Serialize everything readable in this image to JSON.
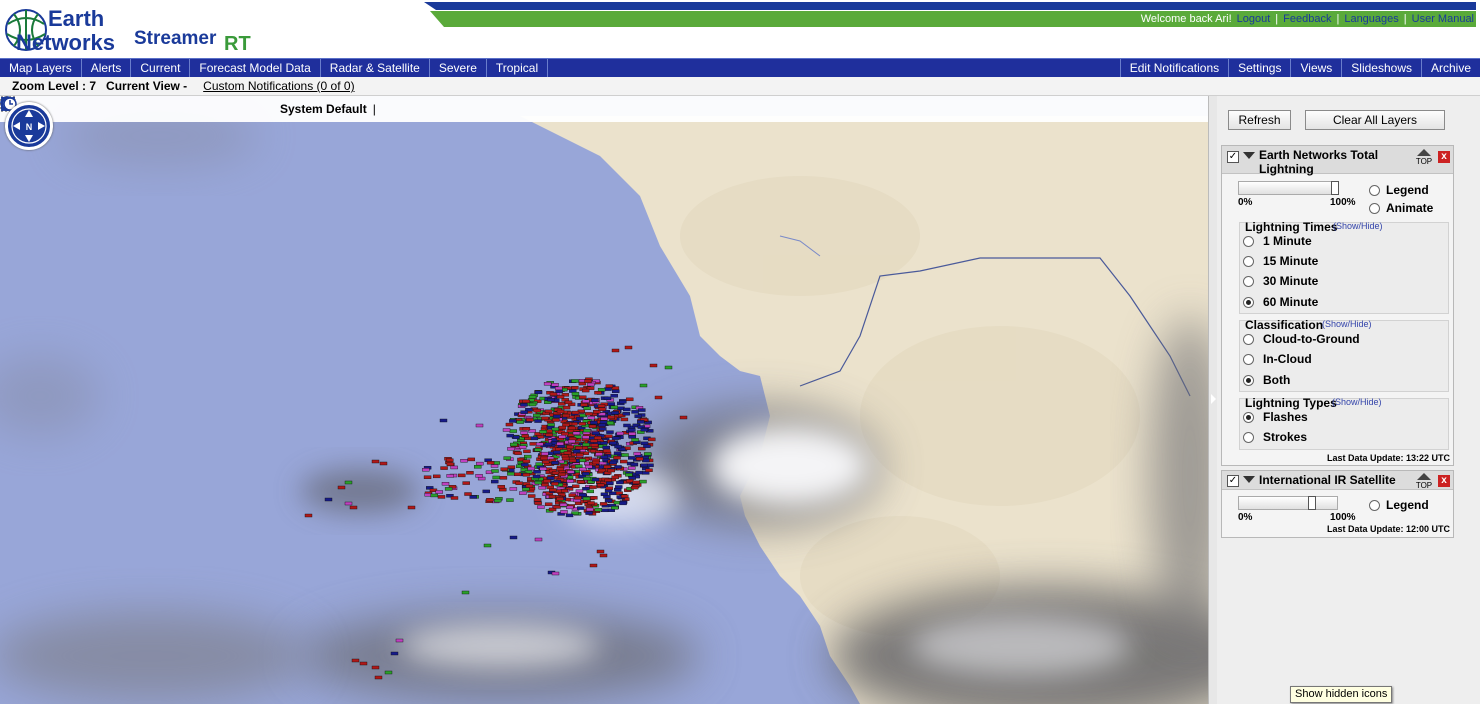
{
  "brand": {
    "name_line1": "Earth",
    "name_line2": "Networks",
    "product": "Streamer",
    "product_suffix": "RT"
  },
  "userbar": {
    "welcome": "Welcome back Ari!",
    "links": [
      "Logout",
      "Feedback",
      "Languages",
      "User Manual"
    ],
    "separator": "|"
  },
  "nav": {
    "left": [
      "Map Layers",
      "Alerts",
      "Current",
      "Forecast Model Data",
      "Radar & Satellite",
      "Severe",
      "Tropical"
    ],
    "right": [
      "Edit Notifications",
      "Settings",
      "Views",
      "Slideshows",
      "Archive"
    ]
  },
  "statusline": {
    "zoom_label": "Zoom Level : 7",
    "view_label": "Current View -",
    "custom": "Custom Notifications (0 of 0)"
  },
  "map_toolbar": {
    "icons": [
      "zoom-in-icon",
      "zoom-out-icon",
      "zoom-box-icon",
      "globe-icon",
      "ruler-icon",
      "line-draw-icon",
      "circle-draw-icon",
      "square-draw-icon",
      "timer-icon"
    ],
    "view_name": "System Default",
    "separator": "|"
  },
  "compass": {
    "north": "N"
  },
  "panel": {
    "refresh": "Refresh",
    "clear_all": "Clear All Layers",
    "layer1": {
      "title_line1": "Earth Networks Total",
      "title_line2": "Lightning",
      "top_label": "TOP",
      "close": "x",
      "opacity_min": "0%",
      "opacity_max": "100%",
      "opacity_value": 1.0,
      "legend": "Legend",
      "animate": "Animate",
      "times_label": "Lightning Times",
      "showhide": "(Show/Hide)",
      "times": [
        "1 Minute",
        "15 Minute",
        "30 Minute",
        "60 Minute"
      ],
      "times_selected": "60 Minute",
      "class_label": "Classification",
      "classes": [
        "Cloud-to-Ground",
        "In-Cloud",
        "Both"
      ],
      "class_selected": "Both",
      "types_label": "Lightning Types",
      "types": [
        "Flashes",
        "Strokes"
      ],
      "types_selected": "Flashes",
      "last_update": "Last Data Update: 13:22 UTC"
    },
    "layer2": {
      "title": "International IR Satellite",
      "top_label": "TOP",
      "close": "x",
      "opacity_min": "0%",
      "opacity_max": "100%",
      "opacity_value": 0.75,
      "legend": "Legend",
      "last_update": "Last Data Update: 12:00 UTC"
    }
  },
  "tooltip": "Show hidden icons",
  "colors": {
    "nav_bg": "#1f2f9c",
    "ocean": "#98a6d8",
    "land": "#ebe2cc",
    "green_stripe": "#5aaa3a",
    "strike_red": "#b01818",
    "strike_green": "#2aa02a",
    "strike_blue": "#161a8a",
    "strike_magenta": "#c040c0"
  }
}
